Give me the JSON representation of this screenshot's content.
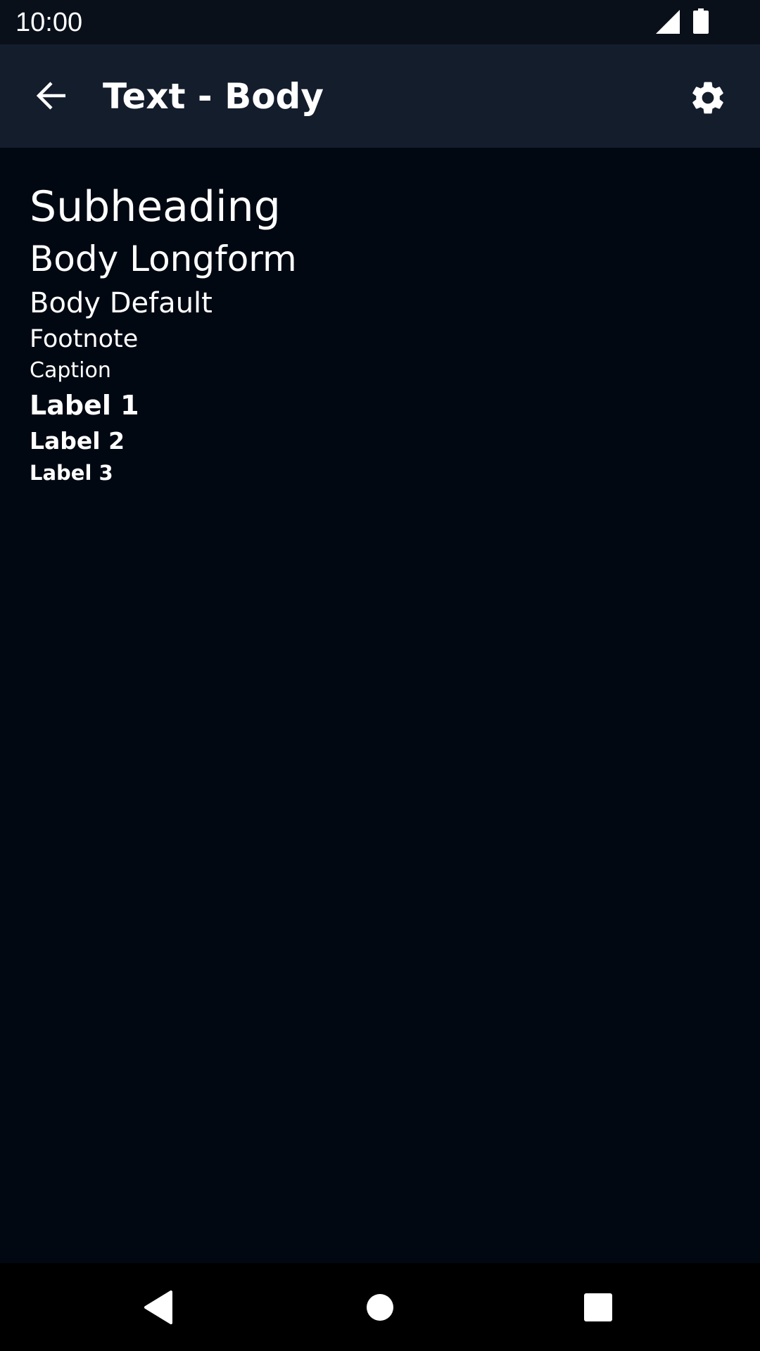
{
  "status_bar": {
    "time": "10:00",
    "icons": [
      "cellular-signal-icon",
      "battery-icon"
    ]
  },
  "app_bar": {
    "back_icon": "arrow-back-icon",
    "title": "Text - Body",
    "settings_icon": "gear-icon"
  },
  "content": {
    "items": [
      "Subheading",
      "Body Longform",
      "Body Default",
      "Footnote",
      "Caption",
      "Label 1",
      "Label 2",
      "Label 3"
    ]
  },
  "nav_bar": {
    "icons": [
      "back-triangle-icon",
      "home-circle-icon",
      "recents-square-icon"
    ]
  },
  "colors": {
    "background": "#020812",
    "status_bar": "#0a101a",
    "app_bar": "#141d2c",
    "nav_bar": "#000000",
    "text": "#ffffff"
  }
}
